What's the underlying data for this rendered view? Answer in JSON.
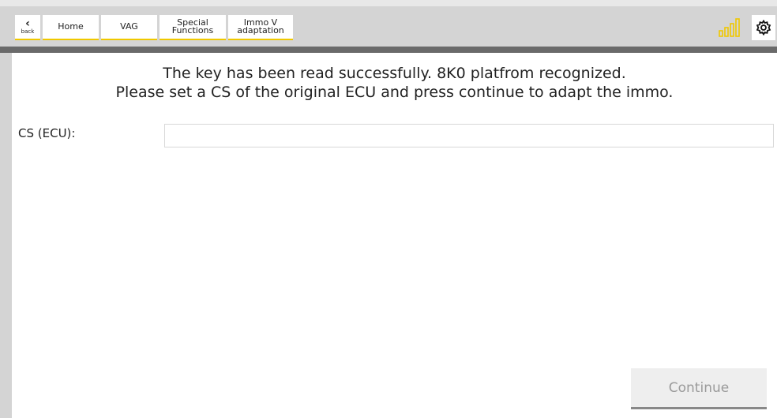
{
  "breadcrumb": {
    "back_label": "back",
    "items": [
      {
        "label": "Home"
      },
      {
        "label": "VAG"
      },
      {
        "label": "Special Functions"
      },
      {
        "label": "Immo V adaptation"
      }
    ]
  },
  "status": {
    "signal_icon": "signal-strength-icon",
    "settings_icon": "gear-icon"
  },
  "message": {
    "line1": "The key has been read successfully. 8K0 platfrom recognized.",
    "line2": "Please set a CS of the original ECU and press continue to adapt the immo."
  },
  "form": {
    "cs_label": "CS (ECU):",
    "cs_value": ""
  },
  "actions": {
    "continue_label": "Continue"
  },
  "colors": {
    "accent": "#f0c800",
    "background": "#d4d4d4",
    "divider": "#6a6a6a"
  }
}
